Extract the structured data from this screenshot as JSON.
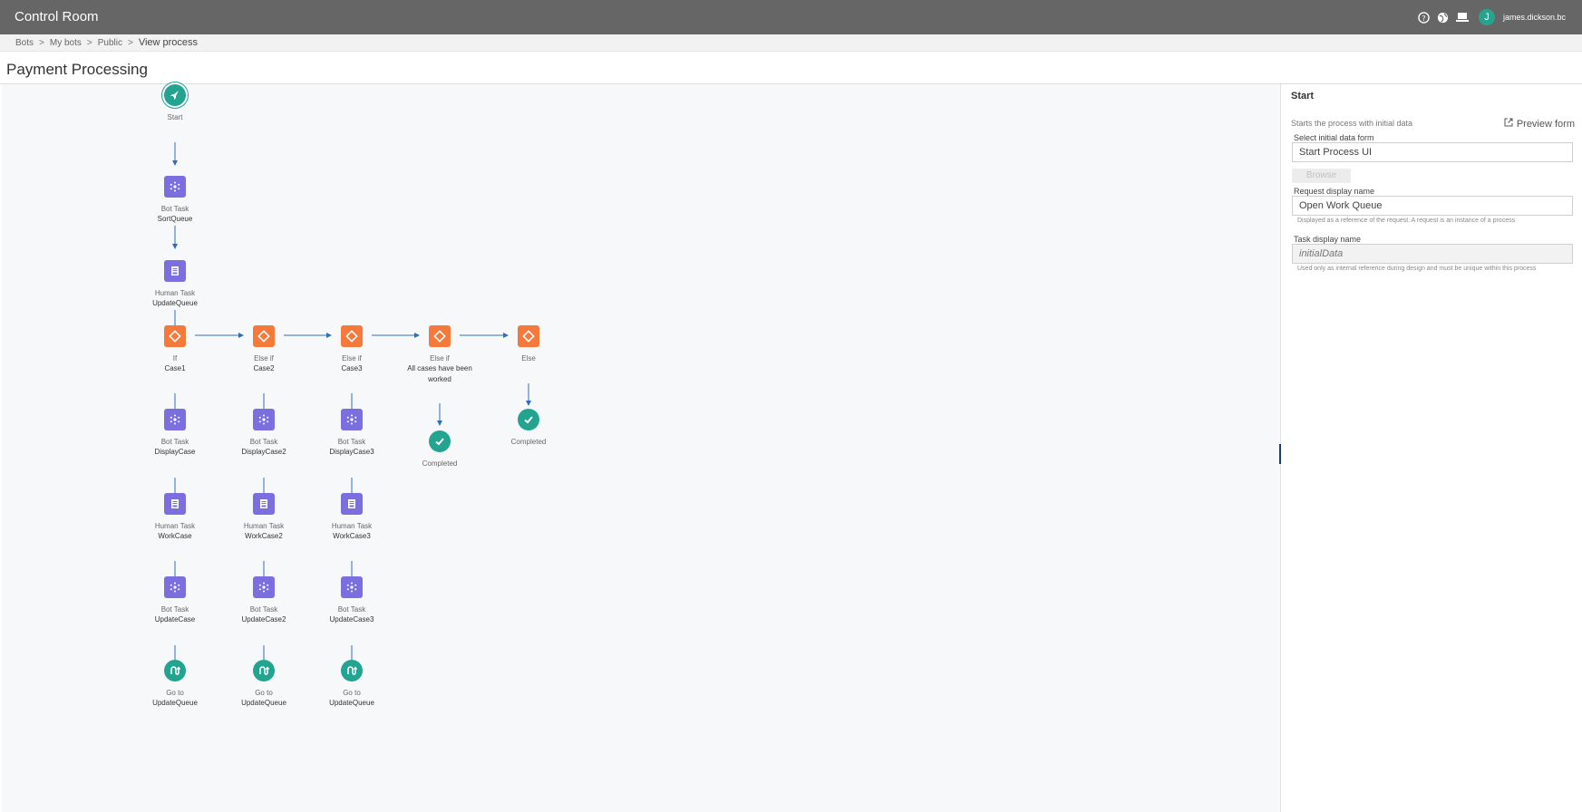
{
  "app": {
    "title": "Control Room",
    "username": "james.dickson.bc",
    "avatar_initial": "J"
  },
  "breadcrumb": [
    "Bots",
    "My bots",
    "Public"
  ],
  "breadcrumb_current": "View process",
  "page_title": "Payment Processing",
  "flow": {
    "start": {
      "label": "Start"
    },
    "sortqueue": {
      "type": "Bot Task",
      "name": "SortQueue"
    },
    "updatequeue": {
      "type": "Human Task",
      "name": "UpdateQueue"
    },
    "branches": [
      {
        "cond_type": "If",
        "cond_name": "Case1",
        "bot1_name": "DisplayCase",
        "human_name": "WorkCase",
        "bot2_name": "UpdateCase"
      },
      {
        "cond_type": "Else if",
        "cond_name": "Case2",
        "bot1_name": "DisplayCase2",
        "human_name": "WorkCase2",
        "bot2_name": "UpdateCase2"
      },
      {
        "cond_type": "Else if",
        "cond_name": "Case3",
        "bot1_name": "DisplayCase3",
        "human_name": "WorkCase3",
        "bot2_name": "UpdateCase3"
      }
    ],
    "bot_type": "Bot Task",
    "human_type": "Human Task",
    "goto_type": "Go to",
    "goto_name": "UpdateQueue",
    "cond4": {
      "type": "Else if",
      "name_line1": "All cases have been",
      "name_line2": "worked"
    },
    "cond5": {
      "type": "Else"
    },
    "completed_label": "Completed"
  },
  "panel": {
    "title": "Start",
    "description": "Starts the process with initial data",
    "preview_label": "Preview form",
    "form_label": "Select initial data form",
    "form_value": "Start Process UI",
    "browse_label": "Browse",
    "request_label": "Request display name",
    "request_value": "Open Work Queue",
    "request_help": "Displayed as a reference of the request. A request is an instance of a process",
    "task_label": "Task display name",
    "task_placeholder": "initialData",
    "task_help": "Used only as internal reference during design and must be unique within this process"
  },
  "colors": {
    "bot": "#7b6fe0",
    "condition": "#f4793b",
    "terminal": "#22a491",
    "connector": "#2f6fb5",
    "topbar": "#666666"
  }
}
